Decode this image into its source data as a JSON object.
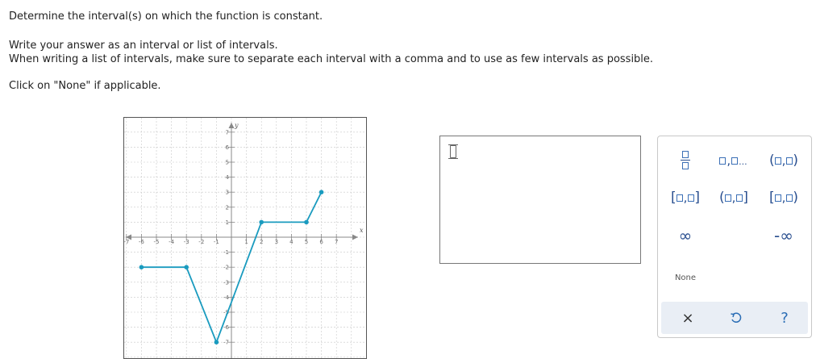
{
  "question": {
    "line1": "Determine the interval(s) on which the function is constant.",
    "line2": "Write your answer as an interval or list of intervals.",
    "line3": "When writing a list of intervals, make sure to separate each interval with a comma and to use as few intervals as possible.",
    "line4": "Click on \"None\" if applicable."
  },
  "graph": {
    "x_axis_label": "x",
    "y_axis_label": "y",
    "x_ticks": [
      -7,
      -6,
      -5,
      -4,
      -3,
      -2,
      -1,
      1,
      2,
      3,
      4,
      5,
      6,
      7
    ],
    "y_ticks": [
      -7,
      -6,
      -5,
      -4,
      -3,
      -2,
      -1,
      1,
      2,
      3,
      4,
      5,
      6,
      7
    ],
    "function_points": [
      [
        -6,
        -2
      ],
      [
        -3,
        -2
      ],
      [
        -1,
        -7
      ],
      [
        2,
        1
      ],
      [
        5,
        1
      ],
      [
        6,
        3
      ]
    ],
    "line_color": "#1a9bbf",
    "grid_color": "#c8c8c8"
  },
  "answer": {
    "value": ""
  },
  "palette": {
    "interval_open_open": "(▢,▢)",
    "interval_closed_closed": "[▢,▢]",
    "interval_open_closed": "(▢,▢]",
    "interval_closed_open": "[▢,▢)",
    "infinity": "∞",
    "neg_infinity": "-∞",
    "none_label": "None",
    "clear_label": "×",
    "help_label": "?",
    "undo_label": "↺",
    "accent": "#2a4f8f"
  }
}
